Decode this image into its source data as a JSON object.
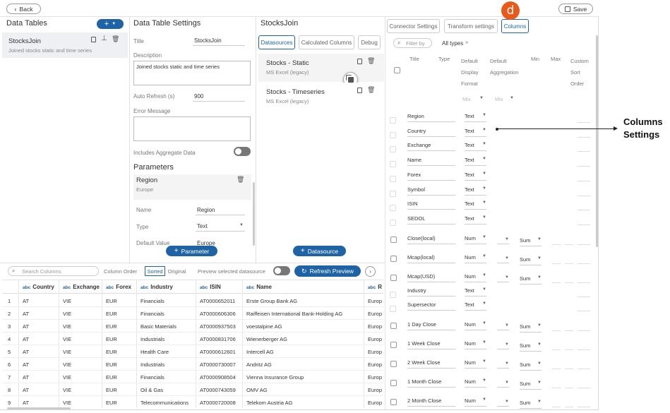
{
  "topbar": {
    "back_label": "Back",
    "save_label": "Save"
  },
  "data_tables": {
    "title": "Data Tables",
    "item_name": "StocksJoin",
    "item_desc": "Joined stocks static and time series"
  },
  "settings": {
    "title": "Data Table Settings",
    "title_label": "Title",
    "title_value": "StocksJoin",
    "description_label": "Description",
    "description_value": "Joined stocks static and time series",
    "auto_refresh_label": "Auto Refresh (s)",
    "auto_refresh_value": "900",
    "error_label": "Error Message",
    "aggregate_label": "Includes Aggregate Data",
    "parameters_title": "Parameters",
    "param_name": "Region",
    "param_sub": "Europe",
    "name_label": "Name",
    "name_value": "Region",
    "type_label": "Type",
    "type_value": "Text",
    "default_label": "Default Value",
    "default_value": "Europe",
    "add_param_label": "Parameter"
  },
  "datasources": {
    "title": "StocksJoin",
    "tabs": [
      "Datasources",
      "Calculated Columns",
      "Debug"
    ],
    "items": [
      {
        "name": "Stocks - Static",
        "type": "MS Excel (legacy)"
      },
      {
        "name": "Stocks - Timeseries",
        "type": "MS Excel (legacy)"
      }
    ],
    "add_label": "Datasource"
  },
  "preview": {
    "search_placeholder": "Search Columns",
    "column_order_label": "Column Order",
    "sorted_label": "Sorted",
    "original_label": "Original",
    "preview_label": "Preview selected datasource",
    "refresh_label": "Refresh Preview",
    "columns": [
      {
        "type": "abc",
        "name": "Country"
      },
      {
        "type": "abc",
        "name": "Exchange"
      },
      {
        "type": "abc",
        "name": "Forex"
      },
      {
        "type": "abc",
        "name": "Industry"
      },
      {
        "type": "abc",
        "name": "ISIN"
      },
      {
        "type": "abc",
        "name": "Name"
      },
      {
        "type": "abc",
        "name": "R"
      }
    ],
    "rows": [
      [
        "1",
        "AT",
        "VIE",
        "EUR",
        "Financials",
        "AT0000652011",
        "Erste Group Bank AG",
        "Europ"
      ],
      [
        "2",
        "AT",
        "VIE",
        "EUR",
        "Financials",
        "AT0000606306",
        "Raiffeisen International Bank-Holding AG",
        "Europ"
      ],
      [
        "3",
        "AT",
        "VIE",
        "EUR",
        "Basic Materials",
        "AT0000937503",
        "voestalpine AG",
        "Europ"
      ],
      [
        "4",
        "AT",
        "VIE",
        "EUR",
        "Industrials",
        "AT0000831706",
        "Wienerberger AG",
        "Europ"
      ],
      [
        "5",
        "AT",
        "VIE",
        "EUR",
        "Health Care",
        "AT0000612601",
        "Intercell AG",
        "Europ"
      ],
      [
        "6",
        "AT",
        "VIE",
        "EUR",
        "Industrials",
        "AT0000730007",
        "Andritz AG",
        "Europ"
      ],
      [
        "7",
        "AT",
        "VIE",
        "EUR",
        "Financials",
        "AT0000908504",
        "Vienna Insurance Group",
        "Europ"
      ],
      [
        "8",
        "AT",
        "VIE",
        "EUR",
        "Oil & Gas",
        "AT0000743059",
        "OMV AG",
        "Europ"
      ],
      [
        "9",
        "AT",
        "VIE",
        "EUR",
        "Telecommunications",
        "AT0000720008",
        "Telekom Austria AG",
        "Europ"
      ]
    ]
  },
  "columns_panel": {
    "tabs": [
      "Connector Settings",
      "Transform settings",
      "Columns"
    ],
    "badge": "d",
    "filter_placeholder": "Filter by",
    "all_types_label": "All types",
    "headers": {
      "title": "Title",
      "type": "Type",
      "default_display_format": [
        "Default",
        "Display",
        "Format"
      ],
      "default_aggregation": [
        "Default",
        "Aggregation"
      ],
      "min": "Min",
      "max": "Max",
      "custom_sort_order": [
        "Custom",
        "Sort",
        "Order"
      ]
    },
    "mixed_format": "Mix",
    "mixed_agg": "Mix",
    "rows": [
      {
        "title": "Region",
        "type": "Text",
        "agg": ""
      },
      {
        "title": "Country",
        "type": "Text",
        "agg": ""
      },
      {
        "title": "Exchange",
        "type": "Text",
        "agg": ""
      },
      {
        "title": "Name",
        "type": "Text",
        "agg": ""
      },
      {
        "title": "Forex",
        "type": "Text",
        "agg": ""
      },
      {
        "title": "Symbol",
        "type": "Text",
        "agg": ""
      },
      {
        "title": "ISIN",
        "type": "Text",
        "agg": ""
      },
      {
        "title": "SEDOL",
        "type": "Text",
        "agg": ""
      },
      {
        "title": "Close(local)",
        "type": "Num",
        "agg": "Sum"
      },
      {
        "title": "Mcap(local)",
        "type": "Num",
        "agg": "Sum"
      },
      {
        "title": "Mcap(USD)",
        "type": "Num",
        "agg": "Sum"
      },
      {
        "title": "Industry",
        "type": "Text",
        "agg": ""
      },
      {
        "title": "Supersector",
        "type": "Text",
        "agg": ""
      },
      {
        "title": "1 Day Close",
        "type": "Num",
        "agg": "Sum"
      },
      {
        "title": "1 Week Close",
        "type": "Num",
        "agg": "Sum"
      },
      {
        "title": "2 Week Close",
        "type": "Num",
        "agg": "Sum"
      },
      {
        "title": "1 Month Close",
        "type": "Num",
        "agg": "Sum"
      },
      {
        "title": "2 Month Close",
        "type": "Num",
        "agg": "Sum"
      }
    ]
  },
  "callout": {
    "line1": "Columns",
    "line2": "Settings"
  },
  "colors": {
    "accent": "#1e63a6",
    "badge": "#e8591a"
  }
}
